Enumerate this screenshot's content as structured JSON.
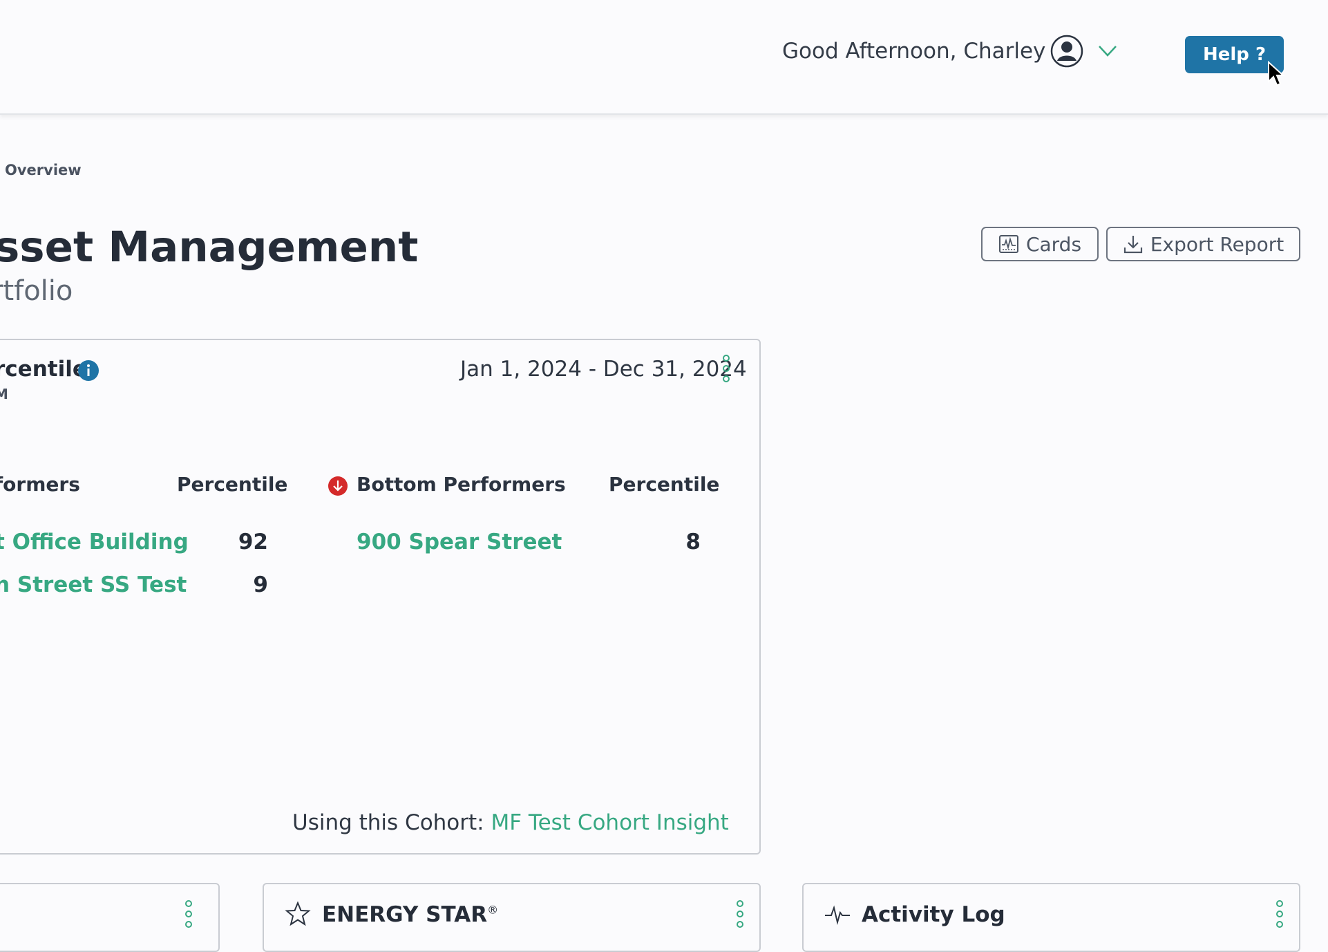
{
  "header": {
    "greeting": "Good Afternoon, Charley",
    "help_label": "Help ?"
  },
  "breadcrumb": "Overview",
  "page": {
    "title": "sset Management",
    "subtitle": "rtfolio"
  },
  "toolbar": {
    "cards_label": "Cards",
    "export_label": "Export Report"
  },
  "percentile_card": {
    "title": "rcentile",
    "subtitle": "M",
    "date_range": "Jan 1, 2024 - Dec 31, 2024",
    "top": {
      "header": "formers",
      "percentile_header": "Percentile",
      "rows": [
        {
          "name": "t Office Building",
          "value": "92"
        },
        {
          "name": "n Street SS Test",
          "value": "9"
        }
      ]
    },
    "bottom": {
      "header": "Bottom Performers",
      "percentile_header": "Percentile",
      "rows": [
        {
          "name": "900 Spear Street",
          "value": "8"
        }
      ]
    },
    "cohort_prefix": "Using this Cohort:",
    "cohort_link": "MF Test Cohort Insight"
  },
  "bottom_cards": {
    "energy_star": "ENERGY STAR",
    "energy_star_mark": "®",
    "activity_log": "Activity Log"
  },
  "colors": {
    "accent_green": "#37a882",
    "help_blue": "#1f74a6",
    "alert_red": "#d42a2a"
  }
}
